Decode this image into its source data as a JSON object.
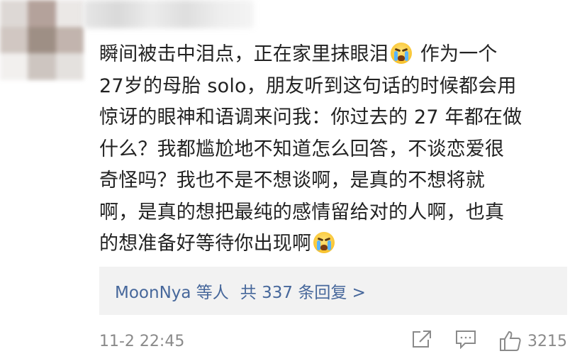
{
  "comment": {
    "lines": [
      "瞬间被击中泪点，正在家里抹眼泪",
      "作为一个",
      "27岁的母胎 solo，朋友听到这句话的时候都会用",
      "惊讶的眼神和语调来问我：你过去的 27 年都在做",
      "什么？我都尴尬地不知道怎么回答，不谈恋爱很",
      "奇怪吗？我也不是不想谈啊，是真的不想将就",
      "啊，是真的想把最纯的感情留给对的人啊，也真",
      "的想准备好等待你出现啊"
    ],
    "emoji_icons": [
      "crying-face-icon",
      "crying-face-icon"
    ]
  },
  "replies": {
    "users": "MoonNya 等人",
    "summary": "共 337 条回复 >"
  },
  "footer": {
    "timestamp": "11-2 22:45",
    "like_count": "3215"
  },
  "colors": {
    "link_blue": "#46679b",
    "meta_gray": "#8a8a8a",
    "reply_bg": "#f2f2f2",
    "text": "#222222"
  }
}
